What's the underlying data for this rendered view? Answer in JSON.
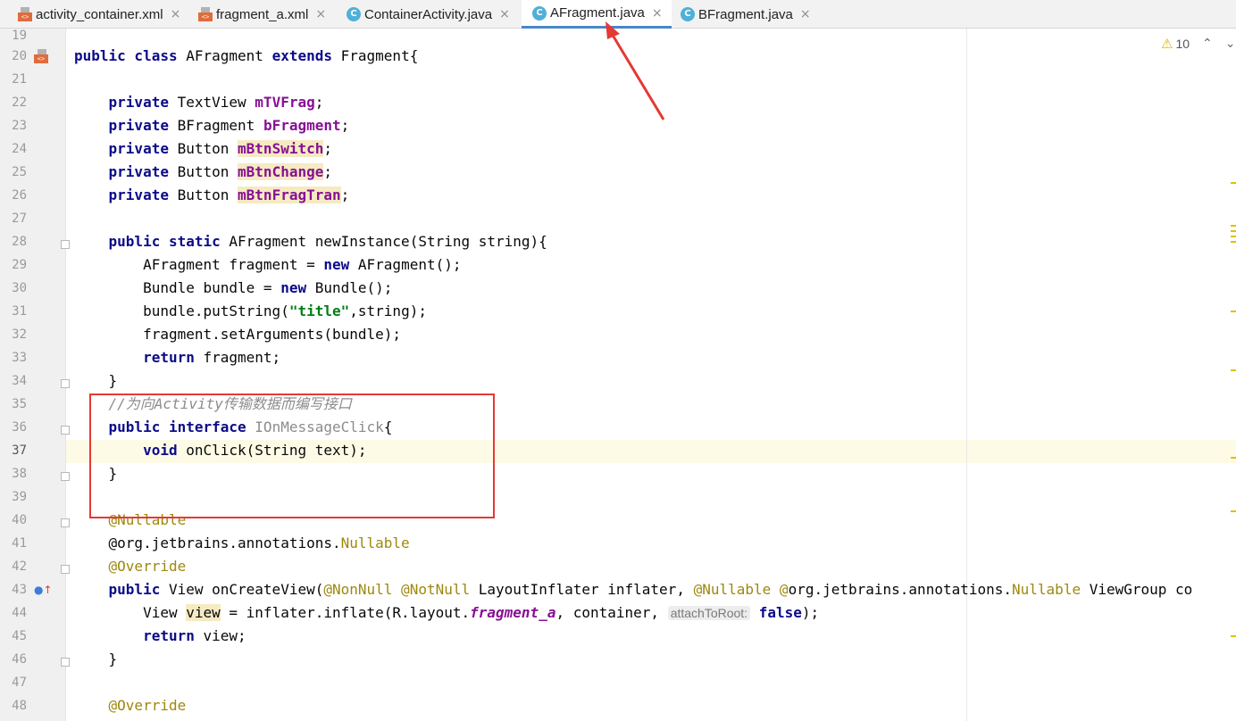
{
  "tabs": [
    {
      "label": "activity_container.xml",
      "icon": "xml-file-icon",
      "active": false
    },
    {
      "label": "fragment_a.xml",
      "icon": "xml-file-icon",
      "active": false
    },
    {
      "label": "ContainerActivity.java",
      "icon": "java-class-icon",
      "active": false
    },
    {
      "label": "AFragment.java",
      "icon": "java-class-icon",
      "active": true
    },
    {
      "label": "BFragment.java",
      "icon": "java-class-icon",
      "active": false
    }
  ],
  "tab_close_glyph": "×",
  "class_icon_glyph": "C",
  "xml_icon_glyph": "<>",
  "editor": {
    "line_numbers": [
      "19",
      "20",
      "21",
      "22",
      "23",
      "24",
      "25",
      "26",
      "27",
      "28",
      "29",
      "30",
      "31",
      "32",
      "33",
      "34",
      "35",
      "36",
      "37",
      "38",
      "39",
      "40",
      "41",
      "42",
      "43",
      "44",
      "45",
      "46",
      "47",
      "48"
    ],
    "current_line": "37",
    "inlay_hint": "attachToRoot:",
    "comment_text": "//为向Activity传输数据而编写接口"
  },
  "inspections": {
    "warning_count": "10",
    "icon": "warning-triangle-icon"
  },
  "colors": {
    "keyword": "#0b0b8a",
    "field": "#871094",
    "string": "#067d17",
    "annotation": "#9e880d",
    "highlight": "#f5eac2",
    "annotation_box": "#e53935",
    "active_tab_underline": "#4a86c8"
  }
}
